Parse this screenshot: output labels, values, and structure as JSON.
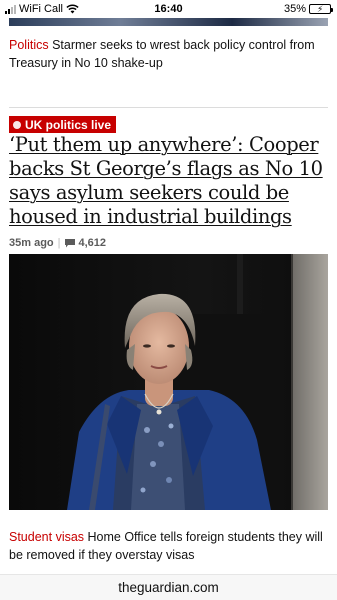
{
  "status_bar": {
    "carrier": "WiFi Call",
    "time": "16:40",
    "battery_percent": "35%",
    "battery_level": 0.35,
    "battery_color": "#f2c94c"
  },
  "top_story": {
    "kicker": "Politics",
    "text": " Starmer seeks to wrest back policy control from Treasury in No 10 shake-up"
  },
  "main_story": {
    "badge": "UK politics live",
    "headline": "‘Put them up anywhere’: Cooper backs St George’s flags as No 10 says asylum seekers could be housed in industrial buildings",
    "age": "35m ago",
    "separator": "|",
    "comment_count": "4,612",
    "image_icon": "photo-of-woman-icon"
  },
  "bottom_story": {
    "kicker": "Student visas",
    "text": " Home Office tells foreign students they will be removed if they overstay visas"
  },
  "browser": {
    "url": "theguardian.com"
  },
  "colors": {
    "accent_red": "#c70000",
    "text": "#121212",
    "meta": "#5b5b5b"
  }
}
